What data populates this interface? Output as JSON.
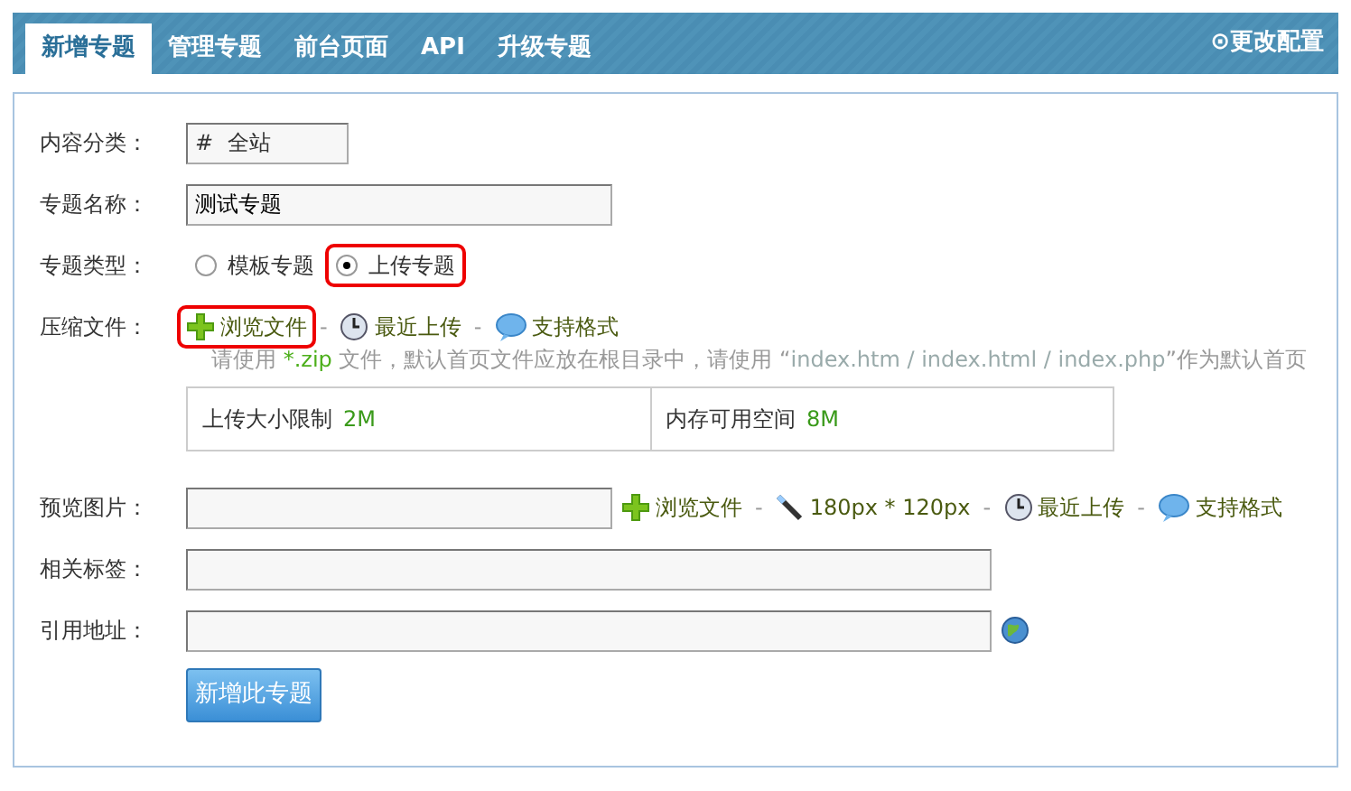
{
  "tabs": [
    {
      "label": "新增专题",
      "selected": true
    },
    {
      "label": "管理专题",
      "selected": false
    },
    {
      "label": "前台页面",
      "selected": false
    },
    {
      "label": "API",
      "selected": false
    },
    {
      "label": "升级专题",
      "selected": false
    }
  ],
  "settings_link": {
    "icon": "⊙",
    "label": "更改配置"
  },
  "form": {
    "category": {
      "label": "内容分类：",
      "symbol": "#",
      "value": "全站"
    },
    "name": {
      "label": "专题名称：",
      "value": "测试专题"
    },
    "type": {
      "label": "专题类型：",
      "options": [
        {
          "label": "模板专题",
          "selected": false,
          "highlighted": false
        },
        {
          "label": "上传专题",
          "selected": true,
          "highlighted": true
        }
      ]
    },
    "archive": {
      "label": "压缩文件：",
      "separator": "-",
      "links": [
        {
          "kind": "plus",
          "label": "浏览文件",
          "highlighted": true
        },
        {
          "kind": "clock",
          "label": "最近上传",
          "highlighted": false
        },
        {
          "kind": "bubble",
          "label": "支持格式",
          "highlighted": false
        }
      ],
      "hint": [
        {
          "kind": "plain",
          "text": "请使用 "
        },
        {
          "kind": "code",
          "text": "*.zip"
        },
        {
          "kind": "plain",
          "text": " 文件，默认首页文件应放在根目录中，请使用 “"
        },
        {
          "kind": "path",
          "text": "index.htm / index.html / index.php"
        },
        {
          "kind": "plain",
          "text": "”作为默认首页"
        }
      ],
      "limits": [
        {
          "label": "上传大小限制",
          "value": "2M"
        },
        {
          "label": "内存可用空间",
          "value": "8M"
        }
      ]
    },
    "preview": {
      "label": "预览图片：",
      "separator": "-",
      "links": [
        {
          "kind": "plus",
          "label": "浏览文件",
          "highlighted": false
        },
        {
          "kind": "wand",
          "label": "180px * 120px",
          "highlighted": false
        },
        {
          "kind": "clock",
          "label": "最近上传",
          "highlighted": false
        },
        {
          "kind": "bubble",
          "label": "支持格式",
          "highlighted": false
        }
      ]
    },
    "tags": {
      "label": "相关标签："
    },
    "url": {
      "label": "引用地址："
    },
    "submit": "新增此专题"
  }
}
